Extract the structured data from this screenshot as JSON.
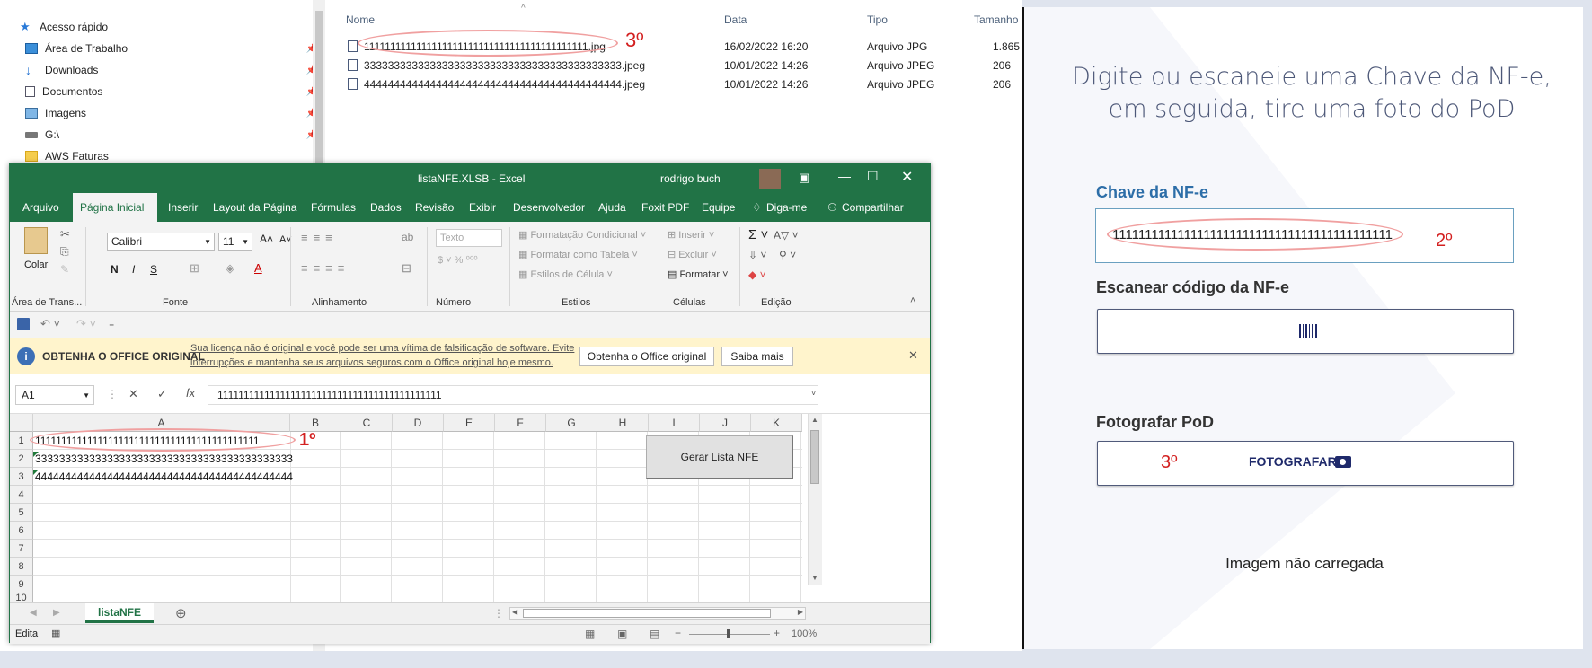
{
  "explorer": {
    "nav_items": [
      {
        "label": "Acesso rápido",
        "icon": "star-icon"
      },
      {
        "label": "Área de Trabalho",
        "icon": "desktop-icon"
      },
      {
        "label": "Downloads",
        "icon": "download-icon"
      },
      {
        "label": "Documentos",
        "icon": "document-icon"
      },
      {
        "label": "Imagens",
        "icon": "picture-icon"
      },
      {
        "label": "G:\\",
        "icon": "drive-icon"
      },
      {
        "label": "AWS Faturas",
        "icon": "folder-icon"
      }
    ],
    "columns": {
      "name": "Nome",
      "date": "Data",
      "type": "Tipo",
      "size": "Tamanho"
    },
    "files": [
      {
        "name": "1111111111111111111111111111111111111111111.jpg",
        "date": "16/02/2022 16:20",
        "type": "Arquivo JPG",
        "size": "1.865"
      },
      {
        "name": "3333333333333333333333333333333333333333333.jpeg",
        "date": "10/01/2022 14:26",
        "type": "Arquivo JPEG",
        "size": "206"
      },
      {
        "name": "4444444444444444444444444444444444444444444.jpeg",
        "date": "10/01/2022 14:26",
        "type": "Arquivo JPEG",
        "size": "206"
      }
    ],
    "annotation": "3º"
  },
  "excel": {
    "title": "listaNFE.XLSB  -  Excel",
    "user": "rodrigo buch",
    "tabs": [
      "Arquivo",
      "Página Inicial",
      "Inserir",
      "Layout da Página",
      "Fórmulas",
      "Dados",
      "Revisão",
      "Exibir",
      "Desenvolvedor",
      "Ajuda",
      "Foxit PDF",
      "Equipe"
    ],
    "tell_me": "Diga-me",
    "share": "Compartilhar",
    "ribbon": {
      "paste": "Colar",
      "font_name": "Calibri",
      "font_size": "11",
      "number_format": "Texto",
      "cond_format": "Formatação Condicional",
      "format_table": "Formatar como Tabela",
      "cell_styles": "Estilos de Célula",
      "insert": "Inserir",
      "delete": "Excluir",
      "format": "Formatar",
      "groups": [
        "Área de Trans...",
        "Fonte",
        "Alinhamento",
        "Número",
        "Estilos",
        "Células",
        "Edição"
      ]
    },
    "message": {
      "title": "OBTENHA O OFFICE ORIGINAL",
      "text1": "Sua licença não é original e você pode ser uma vítima de falsificação de software. Evite",
      "text2": "interrupções e mantenha seus arquivos seguros com o Office original hoje mesmo.",
      "button1": "Obtenha o Office original",
      "button2": "Saiba mais"
    },
    "name_box": "A1",
    "formula": "1111111111111111111111111111111111111111111",
    "columns": [
      "A",
      "B",
      "C",
      "D",
      "E",
      "F",
      "G",
      "H",
      "I",
      "J",
      "K"
    ],
    "rows": [
      "1",
      "2",
      "3",
      "4",
      "5",
      "6",
      "7",
      "8",
      "9",
      "10"
    ],
    "cells": [
      "1111111111111111111111111111111111111111111",
      "3333333333333333333333333333333333333333333",
      "4444444444444444444444444444444444444444444"
    ],
    "macro_button": "Gerar Lista NFE",
    "annotation": "1º",
    "sheet_tab": "listaNFE",
    "status": "Edita",
    "zoom": "100%"
  },
  "app": {
    "title_line1": "Digite ou escaneie uma Chave da NF-e,",
    "title_line2": "em seguida, tire uma foto do PoD",
    "chave_label": "Chave da NF-e",
    "chave_value": "1111111111111111111111111111111111111111111",
    "annotation2": "2º",
    "scan_label": "Escanear código da NF-e",
    "photo_label": "Fotografar PoD",
    "photo_button": "FOTOGRAFAR",
    "annotation3": "3º",
    "image_status": "Imagem não carregada",
    "accent": "#2d6ea8"
  }
}
